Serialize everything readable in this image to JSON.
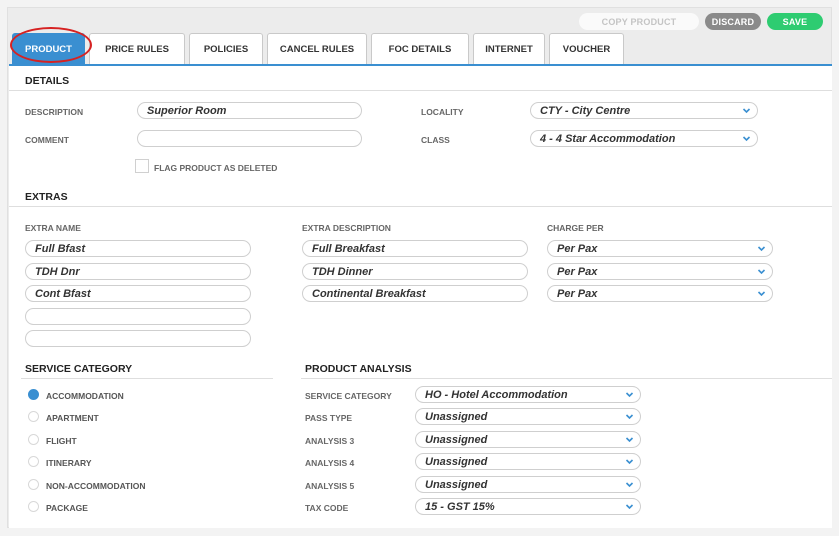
{
  "actions": {
    "copy": "COPY PRODUCT",
    "discard": "DISCARD",
    "save": "SAVE"
  },
  "tabs": [
    "PRODUCT",
    "PRICE RULES",
    "POLICIES",
    "CANCEL RULES",
    "FOC DETAILS",
    "INTERNET",
    "VOUCHER"
  ],
  "details": {
    "title": "DETAILS",
    "description_label": "DESCRIPTION",
    "description": "Superior Room",
    "comment_label": "COMMENT",
    "comment": "",
    "flag_label": "FLAG PRODUCT AS DELETED",
    "locality_label": "LOCALITY",
    "locality": "CTY - City Centre",
    "class_label": "CLASS",
    "class": "4 - 4 Star Accommodation"
  },
  "extras": {
    "title": "EXTRAS",
    "col_name": "EXTRA NAME",
    "col_desc": "EXTRA DESCRIPTION",
    "col_charge": "CHARGE PER",
    "rows": [
      {
        "name": "Full Bfast",
        "desc": "Full Breakfast",
        "charge": "Per Pax"
      },
      {
        "name": "TDH Dnr",
        "desc": "TDH Dinner",
        "charge": "Per Pax"
      },
      {
        "name": "Cont Bfast",
        "desc": "Continental Breakfast",
        "charge": "Per Pax"
      },
      {
        "name": ""
      },
      {
        "name": ""
      }
    ]
  },
  "service_category": {
    "title": "SERVICE CATEGORY",
    "options": [
      "ACCOMMODATION",
      "APARTMENT",
      "FLIGHT",
      "ITINERARY",
      "NON-ACCOMMODATION",
      "PACKAGE"
    ],
    "selected": "ACCOMMODATION"
  },
  "analysis": {
    "title": "PRODUCT ANALYSIS",
    "rows": [
      {
        "label": "SERVICE CATEGORY",
        "value": "HO - Hotel Accommodation"
      },
      {
        "label": "PASS TYPE",
        "value": "Unassigned"
      },
      {
        "label": "ANALYSIS 3",
        "value": "Unassigned"
      },
      {
        "label": "ANALYSIS 4",
        "value": "Unassigned"
      },
      {
        "label": "ANALYSIS 5",
        "value": "Unassigned"
      },
      {
        "label": "TAX CODE",
        "value": "15 - GST 15%"
      }
    ]
  },
  "colors": {
    "accent": "#3a8fd1",
    "save": "#2ecc71",
    "discard": "#8a8a8a",
    "highlight": "#d62222"
  },
  "icons": {
    "dropdown": "chevron-down-icon"
  }
}
